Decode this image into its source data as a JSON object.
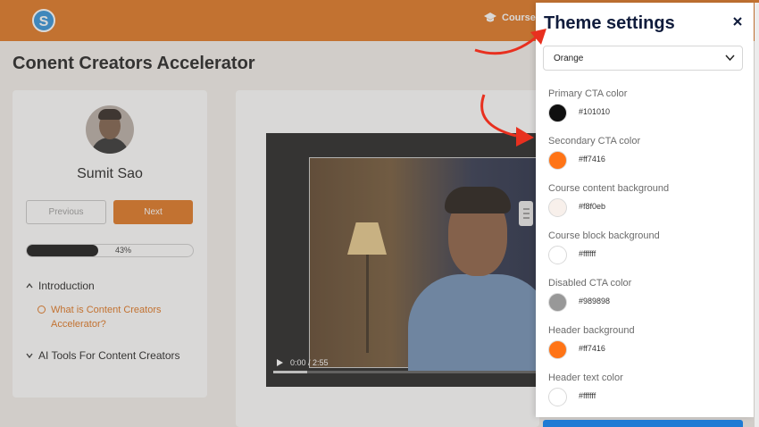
{
  "header": {
    "logo_letter": "S",
    "nav_courses_label": "Courses"
  },
  "page_title": "Conent Creators Accelerator",
  "sidebar": {
    "author_name": "Sumit Sao",
    "previous_label": "Previous",
    "next_label": "Next",
    "progress_percent": 43,
    "progress_text": "43%",
    "sections": [
      {
        "title": "Introduction",
        "expanded": true
      },
      {
        "title": "AI Tools For Content Creators",
        "expanded": false
      }
    ],
    "lesson_title": "What is Content Creators Accelerator?"
  },
  "video": {
    "time_display": "0:00 / 2:55"
  },
  "theme_panel": {
    "title": "Theme settings",
    "selected_theme": "Orange",
    "settings": [
      {
        "label": "Primary CTA color",
        "hex": "#101010",
        "color": "#101010"
      },
      {
        "label": "Secondary CTA color",
        "hex": "#ff7416",
        "color": "#ff7416"
      },
      {
        "label": "Course content background",
        "hex": "#f8f0eb",
        "color": "#f8f0eb"
      },
      {
        "label": "Course block background",
        "hex": "#ffffff",
        "color": "#ffffff"
      },
      {
        "label": "Disabled CTA color",
        "hex": "#989898",
        "color": "#989898"
      },
      {
        "label": "Header background",
        "hex": "#ff7416",
        "color": "#ff7416"
      },
      {
        "label": "Header text color",
        "hex": "#ffffff",
        "color": "#ffffff"
      }
    ]
  },
  "colors": {
    "accent": "#e0721a",
    "annotation_red": "#e8301f",
    "panel_title": "#101c3c"
  }
}
